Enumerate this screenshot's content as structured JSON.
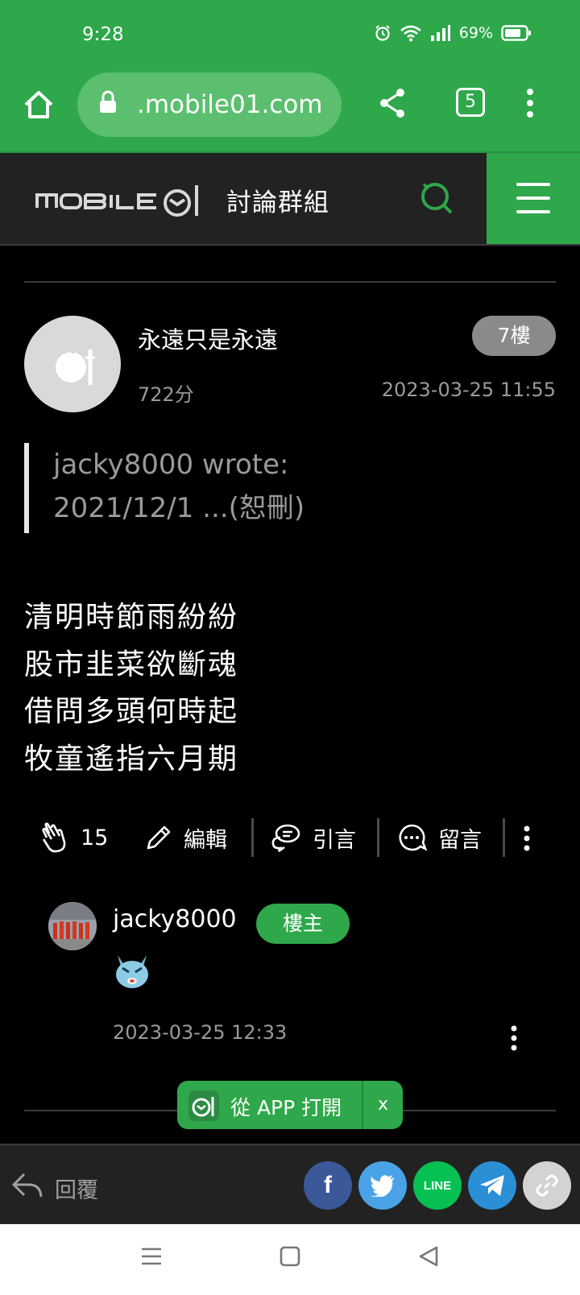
{
  "status_bar": {
    "time": "9:28",
    "battery": "69%"
  },
  "browser": {
    "url": ".mobile01.com",
    "tab_count": "5"
  },
  "site": {
    "logo_text": "MOBILE01",
    "section_title": "討論群組"
  },
  "post": {
    "author": "永遠只是永遠",
    "floor": "7樓",
    "score": "722分",
    "date": "2023-03-25 11:55",
    "quote": {
      "line1": "jacky8000 wrote:",
      "line2": "2021/12/1 ...(恕刪)"
    },
    "poem": [
      "清明時節雨紛紛",
      "股市韭菜欲斷魂",
      "借問多頭何時起",
      "牧童遙指六月期"
    ],
    "actions": {
      "likes": "15",
      "edit": "編輯",
      "quote": "引言",
      "comment": "留言"
    }
  },
  "reply": {
    "author": "jacky8000",
    "badge": "樓主",
    "date": "2023-03-25 12:33"
  },
  "open_in_app": {
    "label": "從 APP 打開",
    "close": "x"
  },
  "bottom_bar": {
    "reply_label": "回覆",
    "social": [
      {
        "name": "facebook",
        "label": "f",
        "color": "#3b5998"
      },
      {
        "name": "twitter",
        "label": "",
        "color": "#4aa3e6"
      },
      {
        "name": "line",
        "label": "LINE",
        "color": "#06c152"
      },
      {
        "name": "telegram",
        "label": "",
        "color": "#2b8fd6"
      },
      {
        "name": "copy-link",
        "label": "",
        "color": "#d3d3d3"
      }
    ]
  },
  "colors": {
    "brand_green": "#2ea84a",
    "header_dark": "#222222",
    "muted": "#9a9a9a"
  }
}
